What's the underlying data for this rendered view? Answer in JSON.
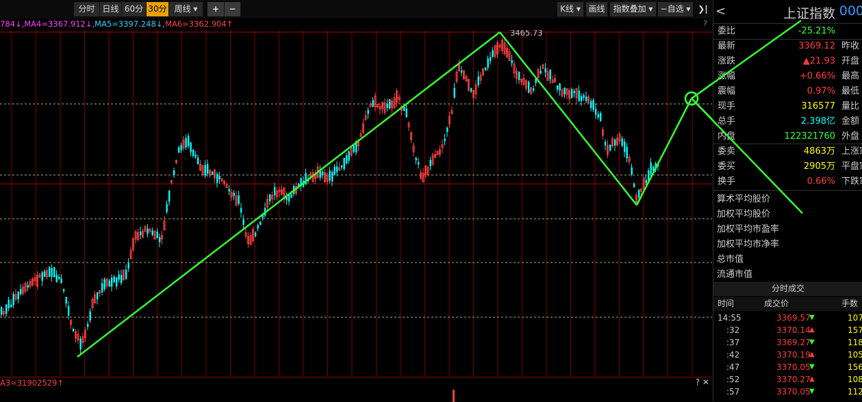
{
  "toolbar": {
    "period_tabs": [
      "分时",
      "日线",
      "60分",
      "30分",
      "周线"
    ],
    "active_period": "30分",
    "dropdown_suffix": "▾",
    "zoom_in": "+",
    "zoom_out": "−",
    "kline_label": "K线 ▾",
    "draw_label": "画线",
    "overlay_label": "指数叠加 ▾",
    "watchlist_label": "−自选 ▾",
    "collapse_icon": "❯|"
  },
  "ma_line": {
    "parts": [
      {
        "text": "784↓,",
        "color": "#ff40ff"
      },
      {
        "text": "MA4=3367.912↓,",
        "color": "#ff40ff"
      },
      {
        "text": "MA5=3397.248↓,",
        "color": "#33ccff"
      },
      {
        "text": "MA6=3362.904↑",
        "color": "#ff4040"
      }
    ],
    "help": "?"
  },
  "chart": {
    "peak_label": "3465.73",
    "colors": {
      "up": "#ff4040",
      "down": "#00ffff",
      "trend": "#33ff33",
      "grid": "#7a0000",
      "dash": "#e6e6a0"
    }
  },
  "volume": {
    "label": "A3=31902529↑",
    "icons": "? ✕"
  },
  "panel": {
    "back_icon": "<",
    "index_name": "上证指数",
    "index_code": "000",
    "wei_bi": {
      "label": "委比",
      "value": "-25.21%"
    },
    "rows": [
      {
        "label": "最新",
        "value": "3369.12",
        "color": "red",
        "label2": "昨收"
      },
      {
        "label": "涨跌",
        "value": "▲21.93",
        "color": "red",
        "label2": "开盘"
      },
      {
        "label": "涨幅",
        "value": "+0.66%",
        "color": "red",
        "label2": "最高"
      },
      {
        "label": "震幅",
        "value": "0.97%",
        "color": "red",
        "label2": "最低"
      },
      {
        "label": "现手",
        "value": "316577",
        "color": "yellow",
        "label2": "量比"
      },
      {
        "label": "总手",
        "value": "2.398亿",
        "color": "cyan",
        "label2": "金额"
      },
      {
        "label": "内盘",
        "value": "122321760",
        "color": "green",
        "label2": "外盘"
      }
    ],
    "rows2": [
      {
        "label": "委卖",
        "value": "4863万",
        "color": "yellow",
        "label2": "上涨家"
      },
      {
        "label": "委买",
        "value": "2905万",
        "color": "yellow",
        "label2": "平盘家"
      },
      {
        "label": "换手",
        "value": "0.66%",
        "color": "red",
        "label2": "下跌家"
      }
    ],
    "stats": [
      "算术平均股价",
      "加权平均股价",
      "加权平均市盈率",
      "加权平均市净率",
      "总市值",
      "流通市值"
    ],
    "trades_title": "分时成交",
    "trades_head": {
      "time": "时间",
      "price": "成交价",
      "volume": "手数"
    },
    "trades": [
      {
        "time": "14:55",
        "price": "3369.57",
        "dir": "▼",
        "vol": "107"
      },
      {
        "time": ":32",
        "price": "3370.14",
        "dir": "▲",
        "vol": "157"
      },
      {
        "time": ":37",
        "price": "3369.27",
        "dir": "▼",
        "vol": "118"
      },
      {
        "time": ":42",
        "price": "3370.19",
        "dir": "▲",
        "vol": "105"
      },
      {
        "time": ":47",
        "price": "3370.05",
        "dir": "▼",
        "vol": "156"
      },
      {
        "time": ":52",
        "price": "3370.27",
        "dir": "▲",
        "vol": "108"
      },
      {
        "time": ":57",
        "price": "3370.05",
        "dir": "▼",
        "vol": "112"
      }
    ]
  }
}
